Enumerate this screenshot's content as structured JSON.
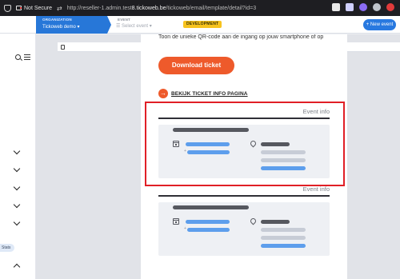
{
  "browser": {
    "security_label": "Not Secure",
    "url_prefix": "http://reseller-1.admin.test",
    "url_host": "8.tickoweb.be",
    "url_path": "/tickoweb/email/template/detail?id=3",
    "extension_colors": [
      "#e8e8e8",
      "#d0d0ff",
      "#8b6cf5",
      "#bfc4cc",
      "#e23b3b"
    ]
  },
  "header": {
    "organization_label": "ORGANIZATION",
    "organization_value": "Tickoweb demo",
    "event_label": "EVENT",
    "event_placeholder": "Select event",
    "environment_badge": "DEVELOPMENT",
    "new_event_label": "+ New event"
  },
  "sidebar": {
    "stats_label": "Stats"
  },
  "email": {
    "intro_text": "Toon de unieke QR-code aan de ingang op jouw smartphone of op",
    "download_button": "Download ticket",
    "info_link_arrow": "→",
    "info_link_text": "BEKIJK TICKET INFO PAGINA",
    "cards": [
      {
        "title": "Event info"
      },
      {
        "title": "Event info"
      }
    ]
  },
  "colors": {
    "brand_blue": "#2777d8",
    "accent_orange": "#ee5a2b",
    "badge_yellow": "#f7c31e",
    "highlight_red": "#e01f26"
  }
}
